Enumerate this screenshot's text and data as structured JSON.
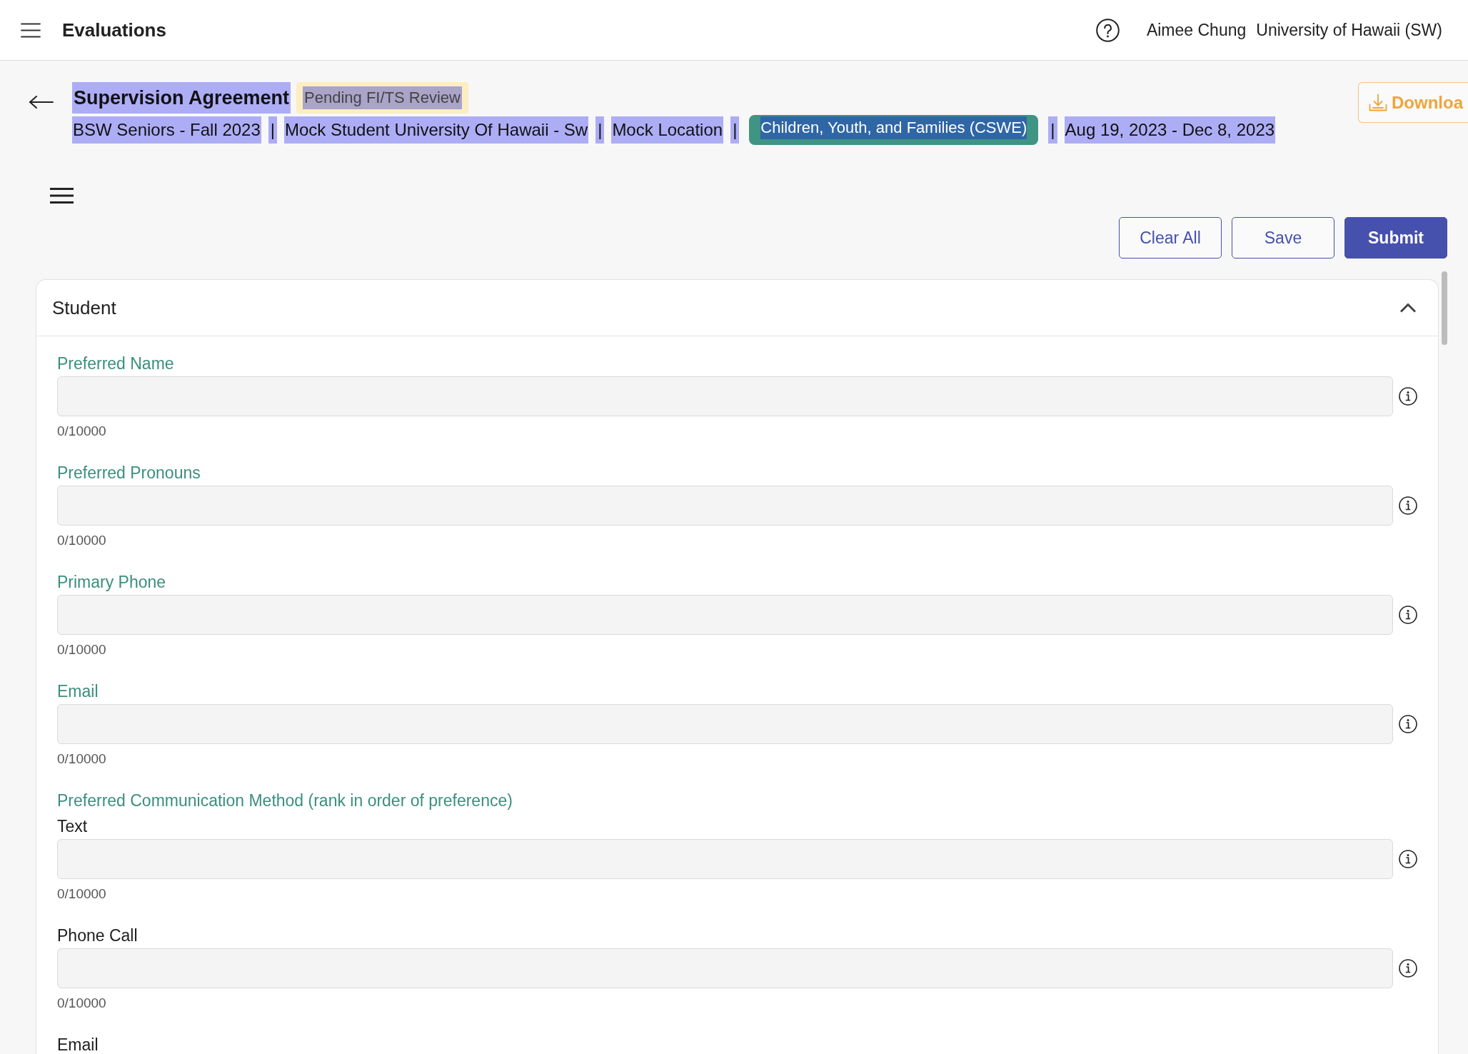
{
  "top_bar": {
    "title": "Evaluations",
    "user_name": "Aimee Chung",
    "organization": "University of Hawaii (SW)"
  },
  "header": {
    "title": "Supervision Agreement",
    "status_badge": "Pending FI/TS Review",
    "text_selected": true,
    "meta": [
      {
        "kind": "text",
        "text": "BSW Seniors - Fall 2023"
      },
      {
        "kind": "separator",
        "text": "|"
      },
      {
        "kind": "text",
        "text": "Mock Student University Of Hawaii - Sw"
      },
      {
        "kind": "separator",
        "text": "|"
      },
      {
        "kind": "text",
        "text": "Mock Location"
      },
      {
        "kind": "separator",
        "text": "|"
      },
      {
        "kind": "tag",
        "text": "Children, Youth, and Families (CSWE)"
      },
      {
        "kind": "separator",
        "text": "|"
      },
      {
        "kind": "text",
        "text": "Aug 19, 2023 - Dec 8, 2023"
      }
    ],
    "download_button": "Downloa"
  },
  "actions": [
    {
      "label": "Clear All",
      "primary": false
    },
    {
      "label": "Save",
      "primary": false
    },
    {
      "label": "Submit",
      "primary": true
    }
  ],
  "section": {
    "title": "Student",
    "expanded": true,
    "fields": [
      {
        "label": "Preferred Name",
        "counter": "0/10000"
      },
      {
        "label": "Preferred Pronouns",
        "counter": "0/10000"
      },
      {
        "label": "Primary Phone",
        "counter": "0/10000"
      },
      {
        "label": "Email",
        "counter": "0/10000"
      }
    ],
    "group": {
      "heading": "Preferred Communication Method (rank in order of preference)",
      "options": [
        {
          "label": "Text",
          "counter": "0/10000"
        },
        {
          "label": "Phone Call",
          "counter": "0/10000"
        },
        {
          "label": "Email"
        }
      ]
    }
  }
}
